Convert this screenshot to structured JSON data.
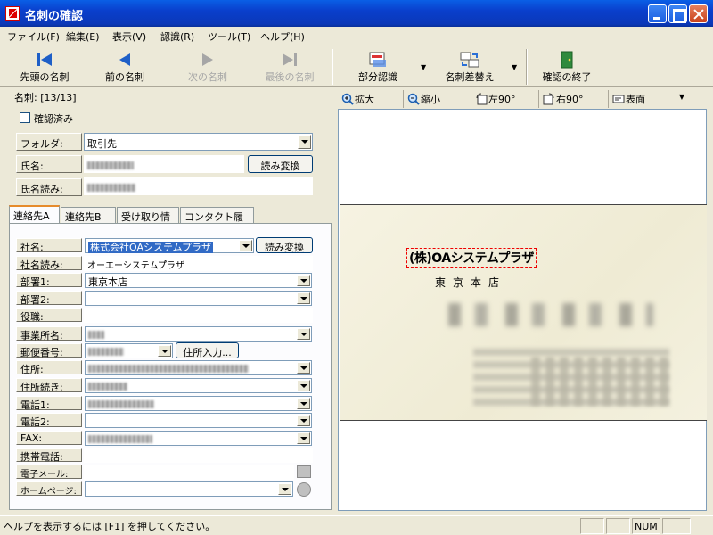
{
  "window": {
    "title": "名刺の確認"
  },
  "menu": [
    "ファイル(F)",
    "編集(E)",
    "表示(V)",
    "認識(R)",
    "ツール(T)",
    "ヘルプ(H)"
  ],
  "toolbar": {
    "first": "先頭の名刺",
    "prev": "前の名刺",
    "next": "次の名刺",
    "last": "最後の名刺",
    "partial_ocr": "部分認識",
    "card_swap": "名刺差替え",
    "finish": "確認の終了"
  },
  "left": {
    "card_counter": "名刺: [13/13]",
    "confirmed_label": "確認済み",
    "folder_label": "フォルダ:",
    "folder_value": "取引先",
    "name_label": "氏名:",
    "reading_convert": "読み変換",
    "name_reading_label": "氏名読み:",
    "tabs": [
      "連絡先A",
      "連絡先B",
      "受け取り情報",
      "コンタクト履歴"
    ],
    "fields": {
      "company_label": "社名:",
      "company_value": "株式会社OAシステムプラザ",
      "company_convert": "読み変換",
      "company_reading_label": "社名読み:",
      "company_reading_value": "オーエーシステムプ゚ラザ",
      "dept1_label": "部署1:",
      "dept1_value": "東京本店",
      "dept2_label": "部署2:",
      "title_label": "役職:",
      "office_label": "事業所名:",
      "postal_label": "郵便番号:",
      "address_input": "住所入力...",
      "address_label": "住所:",
      "address2_label": "住所続き:",
      "phone1_label": "電話1:",
      "phone2_label": "電話2:",
      "fax_label": "FAX:",
      "mobile_label": "携帯電話:",
      "email_label": "電子メール:",
      "homepage_label": "ホームページ:"
    }
  },
  "image_toolbar": {
    "zoom_in": "拡大",
    "zoom_out": "縮小",
    "rotate_left": "左90°",
    "rotate_right": "右90°",
    "side": "表面"
  },
  "card_image": {
    "company": "(株)OAシステムプラザ",
    "branch": "東京本店"
  },
  "status": {
    "help_text": "ヘルプを表示するには [F1] を押してください。",
    "num": "NUM"
  }
}
